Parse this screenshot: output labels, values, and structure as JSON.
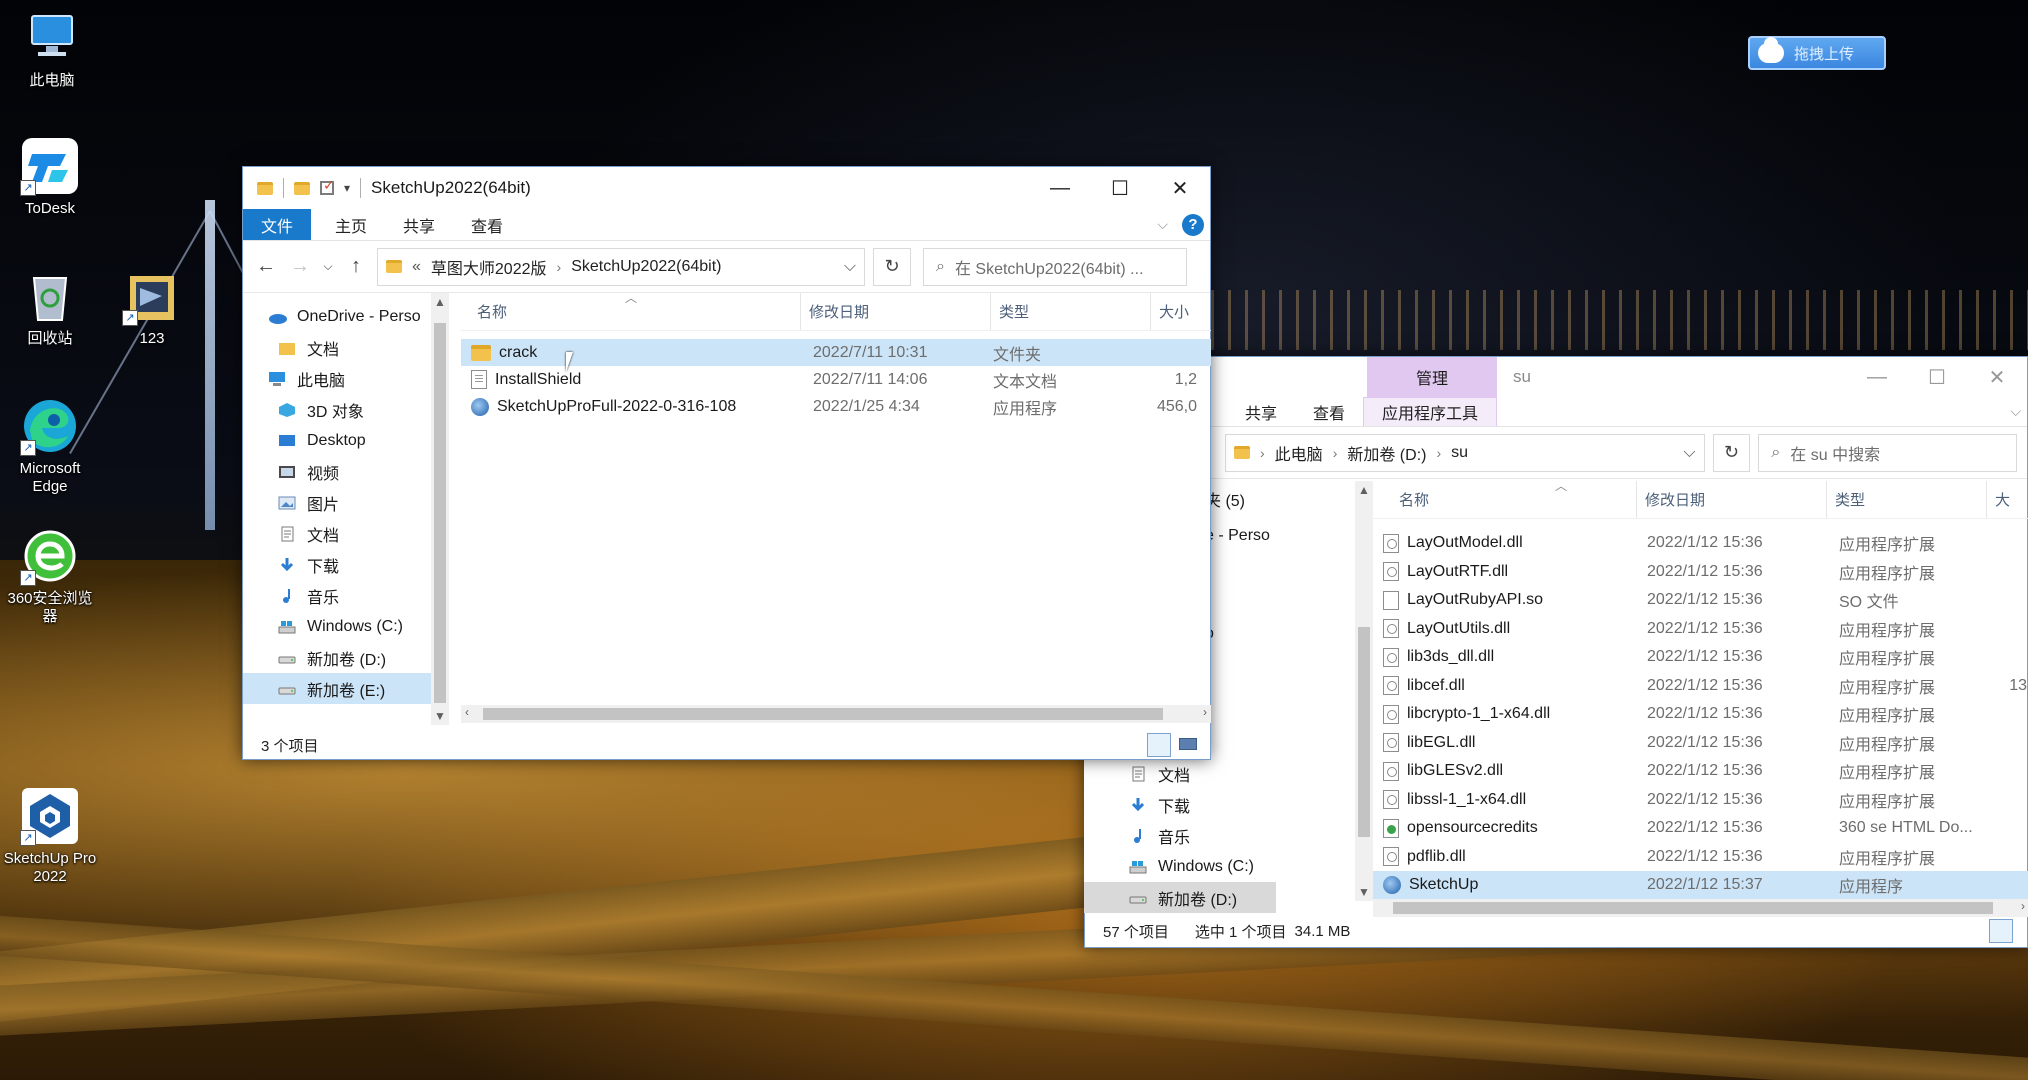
{
  "desktop": {
    "icons": [
      {
        "label": "此电脑",
        "icon": "computer-icon"
      },
      {
        "label": "ToDesk",
        "icon": "todesk-icon"
      },
      {
        "label": "回收站",
        "icon": "recycle-bin-icon"
      },
      {
        "label": "123",
        "icon": "folder-icon"
      },
      {
        "label": "Microsoft Edge",
        "icon": "edge-icon"
      },
      {
        "label": "360安全浏览器",
        "icon": "360-browser-icon"
      },
      {
        "label": "SketchUp Pro 2022",
        "icon": "sketchup-icon"
      }
    ],
    "upload_button": {
      "label": "拖拽上传",
      "icon": "cloud-icon",
      "color": "#3b87e0"
    }
  },
  "window1": {
    "title": "SketchUp2022(64bit)",
    "tabs": [
      "文件",
      "主页",
      "共享",
      "查看"
    ],
    "breadcrumb": {
      "prefix": "«",
      "parts": [
        "草图大师2022版",
        "SketchUp2022(64bit)"
      ]
    },
    "search_placeholder": "在 SketchUp2022(64bit) ...",
    "columns": [
      "名称",
      "修改日期",
      "类型",
      "大小"
    ],
    "nav_items": [
      {
        "label": "OneDrive - Perso",
        "icon": "onedrive-icon",
        "level": 0
      },
      {
        "label": "文档",
        "icon": "folder-icon",
        "level": 1
      },
      {
        "label": "此电脑",
        "icon": "computer-icon",
        "level": 0
      },
      {
        "label": "3D 对象",
        "icon": "3d-objects-icon",
        "level": 1
      },
      {
        "label": "Desktop",
        "icon": "desktop-icon",
        "level": 1
      },
      {
        "label": "视频",
        "icon": "videos-icon",
        "level": 1
      },
      {
        "label": "图片",
        "icon": "pictures-icon",
        "level": 1
      },
      {
        "label": "文档",
        "icon": "documents-icon",
        "level": 1
      },
      {
        "label": "下载",
        "icon": "downloads-icon",
        "level": 1
      },
      {
        "label": "音乐",
        "icon": "music-icon",
        "level": 1
      },
      {
        "label": "Windows (C:)",
        "icon": "windows-drive-icon",
        "level": 1
      },
      {
        "label": "新加卷 (D:)",
        "icon": "drive-icon",
        "level": 1
      },
      {
        "label": "新加卷 (E:)",
        "icon": "drive-icon",
        "level": 1,
        "selected": true
      }
    ],
    "files": [
      {
        "name": "crack",
        "date": "2022/7/11 10:31",
        "type": "文件夹",
        "size": "",
        "icon": "folder-icon",
        "hover": true
      },
      {
        "name": "InstallShield",
        "date": "2022/7/11 14:06",
        "type": "文本文档",
        "size": "1,2",
        "icon": "text-file-icon"
      },
      {
        "name": "SketchUpProFull-2022-0-316-108",
        "date": "2022/1/25 4:34",
        "type": "应用程序",
        "size": "456,0",
        "icon": "installer-icon"
      }
    ],
    "status": "3 个项目"
  },
  "window2": {
    "title": "su",
    "context_tab": "管理",
    "context_tab_color": "#e1c8f0",
    "tabs": [
      "共享",
      "查看",
      "应用程序工具"
    ],
    "breadcrumb": {
      "parts": [
        "此电脑",
        "新加卷 (D:)",
        "su"
      ]
    },
    "search_placeholder": "在 su 中搜索",
    "columns": [
      "名称",
      "修改日期",
      "类型",
      "大"
    ],
    "nav_partial": [
      "夹 (5)",
      "e - Perso",
      "o"
    ],
    "nav_items": [
      {
        "label": "文档",
        "icon": "documents-icon"
      },
      {
        "label": "下载",
        "icon": "downloads-icon"
      },
      {
        "label": "音乐",
        "icon": "music-icon"
      },
      {
        "label": "Windows (C:)",
        "icon": "windows-drive-icon"
      },
      {
        "label": "新加卷 (D:)",
        "icon": "drive-icon",
        "selected": true
      }
    ],
    "files": [
      {
        "name": "LayOutModel.dll",
        "date": "2022/1/12 15:36",
        "type": "应用程序扩展",
        "size": "",
        "icon": "dll-file-icon"
      },
      {
        "name": "LayOutRTF.dll",
        "date": "2022/1/12 15:36",
        "type": "应用程序扩展",
        "size": "",
        "icon": "dll-file-icon"
      },
      {
        "name": "LayOutRubyAPI.so",
        "date": "2022/1/12 15:36",
        "type": "SO 文件",
        "size": "",
        "icon": "blank-file-icon"
      },
      {
        "name": "LayOutUtils.dll",
        "date": "2022/1/12 15:36",
        "type": "应用程序扩展",
        "size": "",
        "icon": "dll-file-icon"
      },
      {
        "name": "lib3ds_dll.dll",
        "date": "2022/1/12 15:36",
        "type": "应用程序扩展",
        "size": "",
        "icon": "dll-file-icon"
      },
      {
        "name": "libcef.dll",
        "date": "2022/1/12 15:36",
        "type": "应用程序扩展",
        "size": "13",
        "icon": "dll-file-icon"
      },
      {
        "name": "libcrypto-1_1-x64.dll",
        "date": "2022/1/12 15:36",
        "type": "应用程序扩展",
        "size": "",
        "icon": "dll-file-icon"
      },
      {
        "name": "libEGL.dll",
        "date": "2022/1/12 15:36",
        "type": "应用程序扩展",
        "size": "",
        "icon": "dll-file-icon"
      },
      {
        "name": "libGLESv2.dll",
        "date": "2022/1/12 15:36",
        "type": "应用程序扩展",
        "size": "",
        "icon": "dll-file-icon"
      },
      {
        "name": "libssl-1_1-x64.dll",
        "date": "2022/1/12 15:36",
        "type": "应用程序扩展",
        "size": "",
        "icon": "dll-file-icon"
      },
      {
        "name": "opensourcecredits",
        "date": "2022/1/12 15:36",
        "type": "360 se HTML Do...",
        "size": "",
        "icon": "html-file-icon"
      },
      {
        "name": "pdflib.dll",
        "date": "2022/1/12 15:36",
        "type": "应用程序扩展",
        "size": "",
        "icon": "dll-file-icon"
      },
      {
        "name": "SketchUp",
        "date": "2022/1/12 15:37",
        "type": "应用程序",
        "size": "",
        "icon": "sketchup-app-icon",
        "selected": true
      }
    ],
    "status": {
      "count": "57 个项目",
      "selection": "选中 1 个项目",
      "size": "34.1 MB"
    }
  }
}
